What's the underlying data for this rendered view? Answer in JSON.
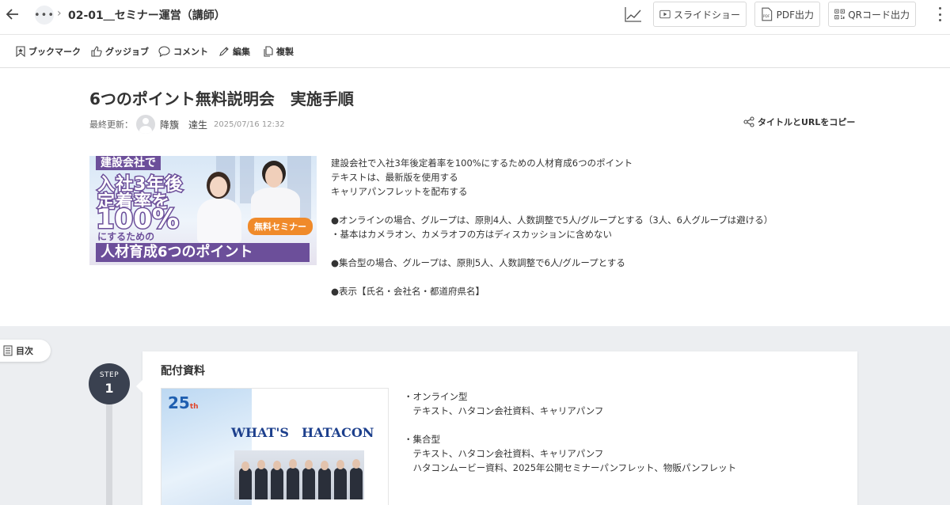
{
  "header": {
    "more_label": "•••",
    "breadcrumb_title": "02-01＿セミナー運営（講師）",
    "slideshow_label": "スライドショー",
    "pdf_label": "PDF出力",
    "qr_label": "QRコード出力"
  },
  "actions": {
    "bookmark": "ブックマーク",
    "good_job": "グッジョブ",
    "comment": "コメント",
    "edit": "編集",
    "duplicate": "複製"
  },
  "article": {
    "title": "6つのポイント無料説明会　実施手順",
    "updated_label": "最終更新：",
    "author": "降籏　達生",
    "updated_at": "2025/07/16 12:32",
    "copy_label": "タイトルとURLをコピー",
    "banner": {
      "line_tag": "建設会社で",
      "line_a": "入社3年後",
      "line_b": "定着率を",
      "line_c": "100%",
      "line_d": "にするための",
      "line_e": "人材育成6つのポイント",
      "seminar": "無料セミナー"
    },
    "description": [
      "建設会社で入社3年後定着率を100%にするための人材育成6つのポイント",
      "テキストは、最新版を使用する",
      "キャリアパンフレットを配布する",
      "",
      "●オンラインの場合、グループは、原則4人、人数調整で5人/グループとする（3人、6人グループは避ける）",
      "・基本はカメラオン、カメラオフの方はディスカッションに含めない",
      "",
      "●集合型の場合、グループは、原則5人、人数調整で6人/グループとする",
      "",
      "●表示【氏名・会社名・都道府県名】"
    ]
  },
  "toc": {
    "label": "目次"
  },
  "steps": [
    {
      "label": "STEP",
      "number": "1",
      "title": "配付資料",
      "thumb": {
        "badge": "25",
        "badge_suffix": "th",
        "heading": "WHAT'S　HATACON"
      },
      "lines": [
        "・オンライン型",
        "　テキスト、ハタコン会社資料、キャリアパンフ",
        "",
        "・集合型",
        "　テキスト、ハタコン会社資料、キャリアパンフ",
        "　ハタコンムービー資料、2025年公開セミナーパンフレット、物販パンフレット"
      ]
    }
  ],
  "colors": {
    "banner_purple": "#6c4f9a",
    "seminar_orange": "#f08a2a",
    "step_circle": "#3a4150",
    "section_bg": "#eceef1"
  }
}
